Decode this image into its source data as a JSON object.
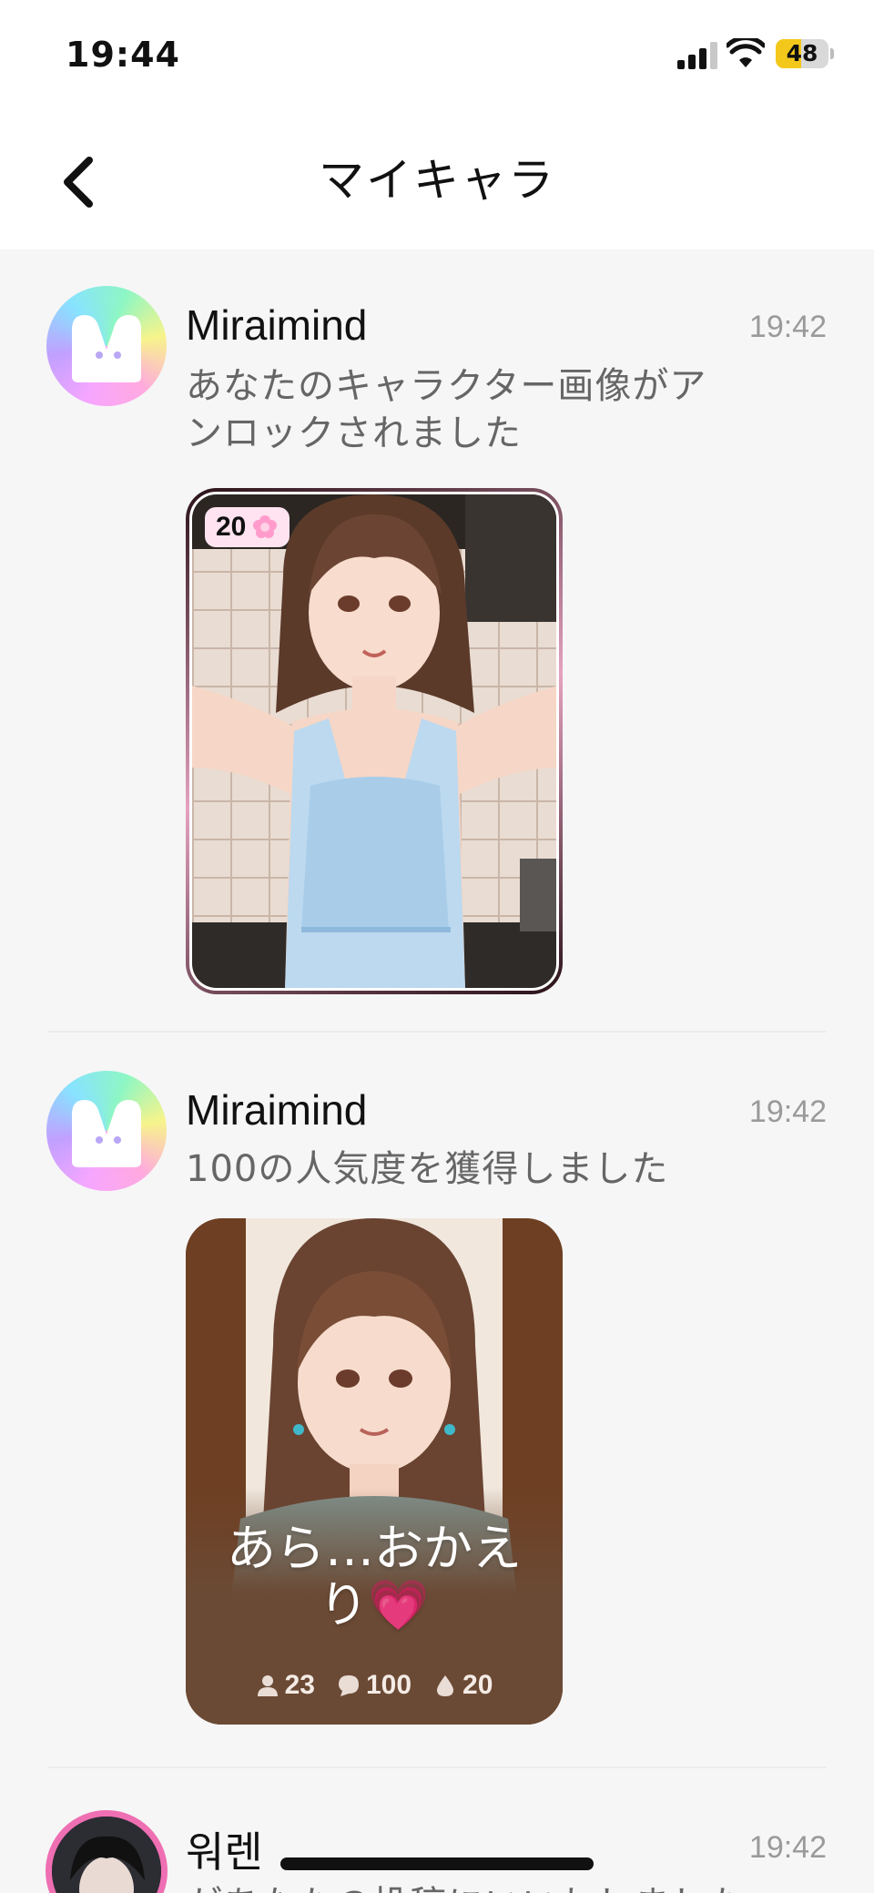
{
  "status_bar": {
    "time": "19:44",
    "battery": "48",
    "battery_level": 0.48
  },
  "nav": {
    "title": "マイキャラ",
    "back_icon": "chevron-left-icon"
  },
  "messages": [
    {
      "sender": "Miraimind",
      "time": "19:42",
      "text": "あなたのキャラクター画像がアンロックされました",
      "card": {
        "badge_count": "20"
      }
    },
    {
      "sender": "Miraimind",
      "time": "19:42",
      "text": "100の人気度を獲得しました",
      "card": {
        "caption": "あら…おかえり💗",
        "stats": {
          "users": "23",
          "comments": "100",
          "likes": "20"
        }
      }
    },
    {
      "sender": "워렌",
      "time": "19:42",
      "text": "があなたの投稿にいいねしました"
    }
  ]
}
